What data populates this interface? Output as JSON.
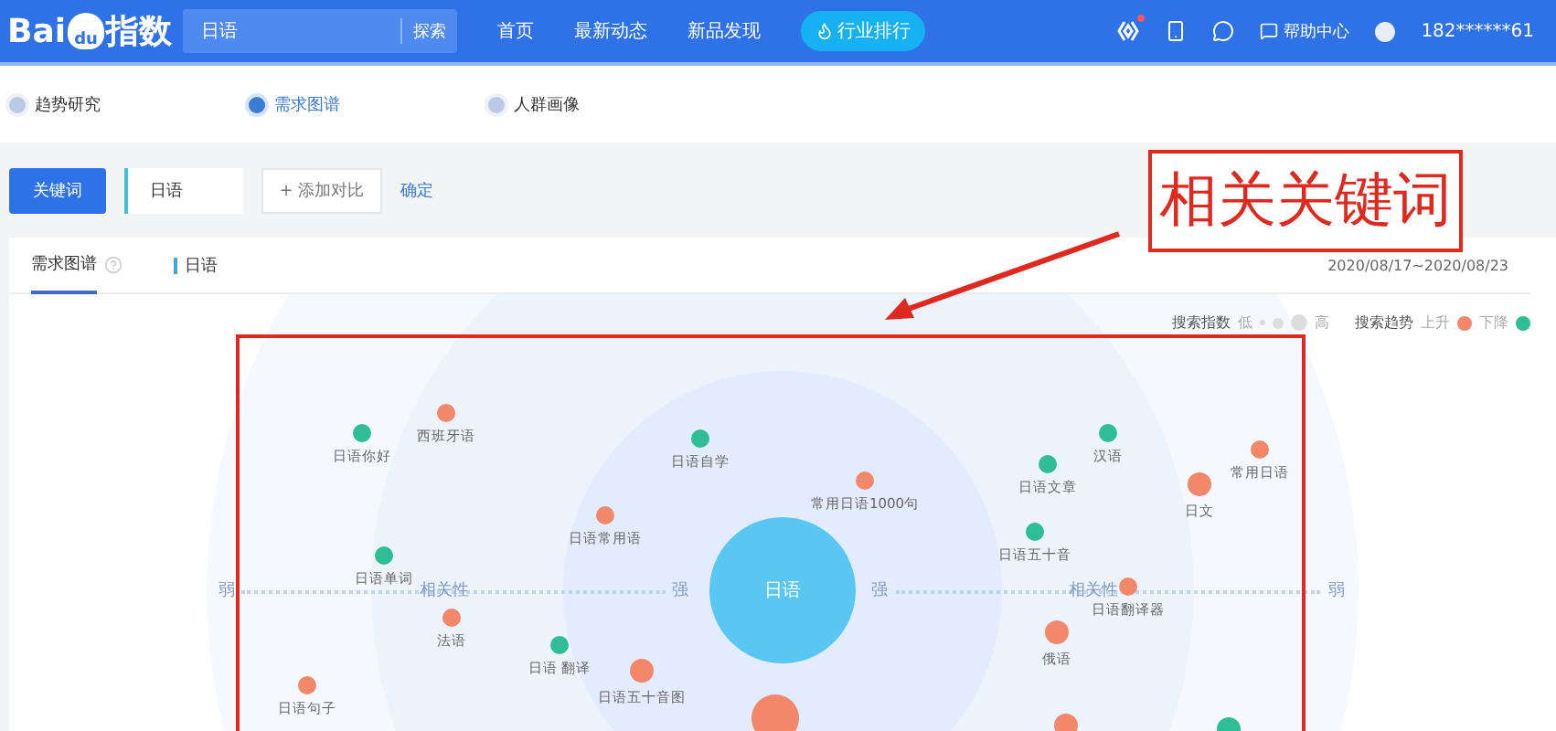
{
  "header": {
    "logo": {
      "left": "Bai",
      "paw": "du",
      "right": "指数"
    },
    "search": {
      "value": "日语",
      "button": "探索"
    },
    "nav": [
      {
        "label": "首页",
        "kind": "link"
      },
      {
        "label": "最新动态",
        "kind": "link"
      },
      {
        "label": "新品发现",
        "kind": "link"
      },
      {
        "label": "行业排行",
        "kind": "pill"
      }
    ],
    "unread": true,
    "help": "帮助中心",
    "user": "182******61"
  },
  "subnav": [
    {
      "label": "趋势研究",
      "selected": false
    },
    {
      "label": "需求图谱",
      "selected": true
    },
    {
      "label": "人群画像",
      "selected": false
    }
  ],
  "toolbar": {
    "keyword_button": "关键词",
    "keyword": "日语",
    "add_compare": "+ 添加对比",
    "confirm": "确定"
  },
  "card": {
    "tabs": [
      {
        "label": "需求图谱",
        "selected": true
      }
    ],
    "keyword": "日语",
    "date_range": "2020/08/17~2020/08/23",
    "legend": {
      "index_label": "搜索指数",
      "low": "低",
      "high": "高",
      "trend_label": "搜索趋势",
      "up": "上升",
      "down": "下降"
    },
    "center": "日语",
    "axis": [
      "弱",
      "相关性",
      "强",
      "强",
      "相关性",
      "弱"
    ],
    "nodes": [
      {
        "label": "日语你好",
        "color": "#2ebd94",
        "kind": "small"
      },
      {
        "label": "西班牙语",
        "color": "#f2876a",
        "kind": "small"
      },
      {
        "label": "日语自学",
        "color": "#2ebd94",
        "kind": "small"
      },
      {
        "label": "常用日语1000句",
        "color": "#f2876a",
        "kind": "small"
      },
      {
        "label": "日语常用语",
        "color": "#f2876a",
        "kind": "small"
      },
      {
        "label": "日语文章",
        "color": "#2ebd94",
        "kind": "small"
      },
      {
        "label": "汉语",
        "color": "#2ebd94",
        "kind": "small"
      },
      {
        "label": "常用日语",
        "color": "#f2876a",
        "kind": "small"
      },
      {
        "label": "日文",
        "color": "#f2876a",
        "kind": "medium"
      },
      {
        "label": "日语单词",
        "color": "#2ebd94",
        "kind": "small"
      },
      {
        "label": "日语五十音",
        "color": "#2ebd94",
        "kind": "small"
      },
      {
        "label": "日语翻译器",
        "color": "#f2876a",
        "kind": "small"
      },
      {
        "label": "法语",
        "color": "#f2876a",
        "kind": "small"
      },
      {
        "label": "俄语",
        "color": "#f2876a",
        "kind": "medium"
      },
      {
        "label": "日语 翻译",
        "color": "#2ebd94",
        "kind": "small"
      },
      {
        "label": "日语五十音图",
        "color": "#f2876a",
        "kind": "medium"
      },
      {
        "label": "日语句子",
        "color": "#f2876a",
        "kind": "small"
      },
      {
        "color": "#f2876a",
        "kind": "large"
      },
      {
        "color": "#f2876a",
        "kind": "medium"
      },
      {
        "color": "#2ebd94",
        "kind": "medium"
      }
    ]
  },
  "annotation": {
    "callout": "相关关键词"
  }
}
